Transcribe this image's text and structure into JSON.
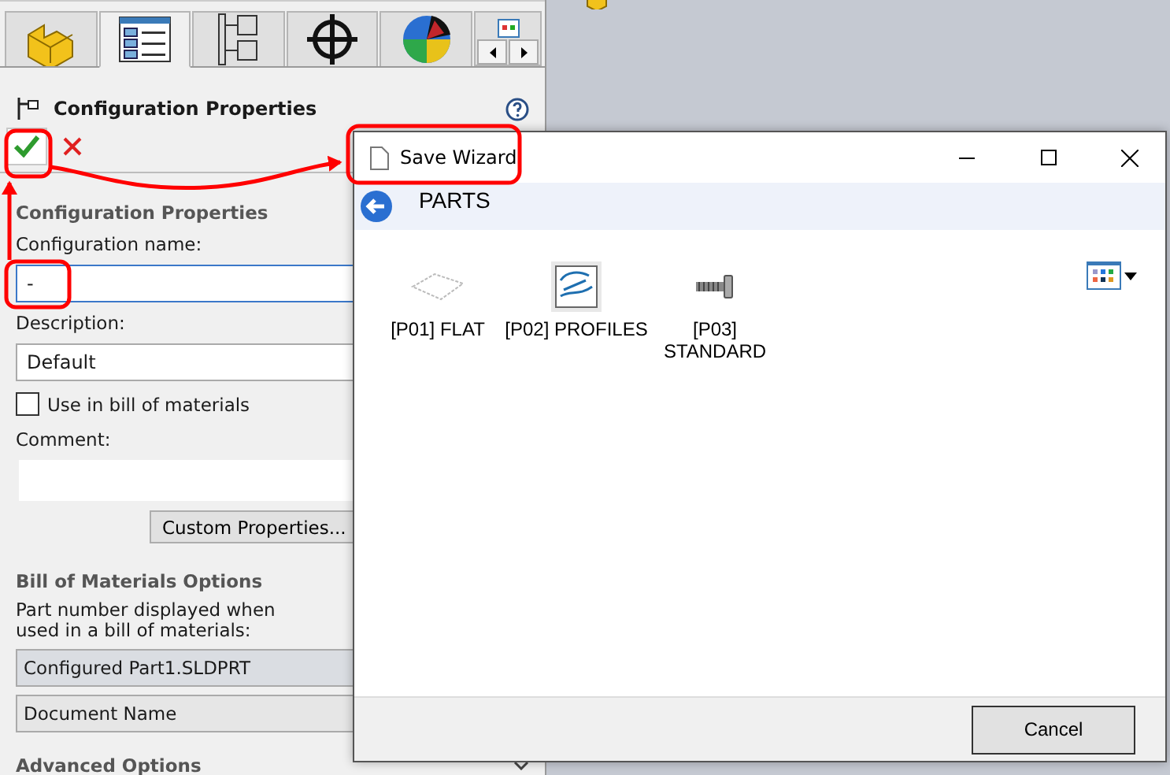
{
  "tabs": [
    {
      "kind": "part",
      "selected": false
    },
    {
      "kind": "properties",
      "selected": true
    },
    {
      "kind": "tree",
      "selected": false
    },
    {
      "kind": "target",
      "selected": false
    },
    {
      "kind": "appearance",
      "selected": false
    },
    {
      "kind": "more",
      "selected": false
    }
  ],
  "panel": {
    "title": "Configuration Properties",
    "section_title": "Configuration Properties",
    "name_label": "Configuration name:",
    "name_value": "-",
    "description_label": "Description:",
    "description_value": "Default",
    "bom_checkbox": {
      "label": "Use in bill of materials",
      "checked": false
    },
    "comment_label": "Comment:",
    "custom_button": "Custom Properties...",
    "bom_section": "Bill of Materials Options",
    "part_number_label": "Part number displayed when used in a bill of materials:",
    "part_number_value": "Configured Part1.SLDPRT",
    "part_number_source": "Document Name",
    "advanced_section": "Advanced Options"
  },
  "dialog": {
    "title": "Save Wizard",
    "location": "PARTS",
    "items": [
      {
        "label": "[P01] FLAT",
        "kind": "flat"
      },
      {
        "label": "[P02] PROFILES",
        "kind": "profiles"
      },
      {
        "label": "[P03] STANDARD",
        "kind": "standard"
      }
    ],
    "cancel": "Cancel"
  }
}
